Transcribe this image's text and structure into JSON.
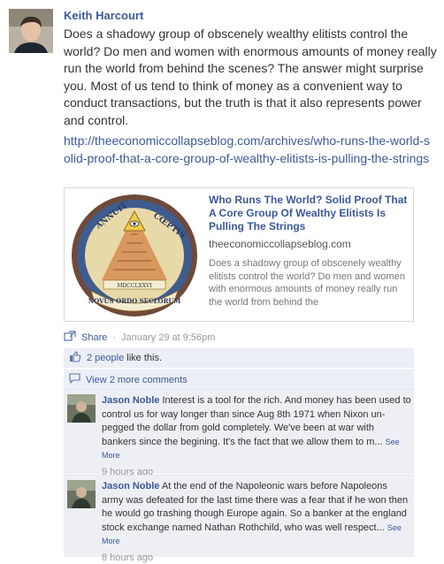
{
  "post": {
    "author": "Keith Harcourt",
    "message": "Does a shadowy group of obscenely wealthy elitists control the world? Do men and women with enormous amounts of money really run the world from behind the scenes? The answer might surprise you. Most of us tend to think of money as a convenient way to conduct transactions, but the truth is that it also represents power and control.",
    "link": "http://theeconomiccollapseblog.com/archives/who-runs-the-world-solid-proof-that-a-core-group-of-wealthy-elitists-is-pulling-the-strings"
  },
  "shared": {
    "title": "Who Runs The World? Solid Proof That A Core Group Of Wealthy Elitists Is Pulling The Strings",
    "domain": "theeconomiccollapseblog.com",
    "description": "Does a shadowy group of obscenely wealthy elitists control the world? Do men and women with enormous amounts of money really run the world from behind the",
    "seal_text": {
      "top_left": "ANNUIT",
      "top_right": "CŒPTIS",
      "bottom": "NOVUS ORDO SECLORUM",
      "year": "MDCCLXXVI"
    }
  },
  "meta": {
    "share": "Share",
    "separator": "·",
    "time": "January 29 at 9:56pm"
  },
  "likes": {
    "count_text": "2 people",
    "suffix": "like this."
  },
  "view_more": "View 2 more comments",
  "comments": [
    {
      "author": "Jason Noble",
      "text": "Interest is a tool for the rich. And money has been used to control us for way longer than since Aug 8th 1971 when Nixon un-pegged the dollar from gold completely. We've been at war with bankers since the begining. It's the fact that we allow them to m...",
      "see_more": "See More",
      "time": "9 hours ago"
    },
    {
      "author": "Jason Noble",
      "text": "At the end of the Napoleonic wars before Napoleons army was defeated for the last time there was a fear that if he won then he would go trashing though Europe again. So a banker at the england stock exchange named Nathan Rothchild, who was well respect...",
      "see_more": "See More",
      "time": "8 hours ago"
    }
  ],
  "colors": {
    "link_blue": "#3b5998",
    "ufi_background": "#eceff5"
  }
}
